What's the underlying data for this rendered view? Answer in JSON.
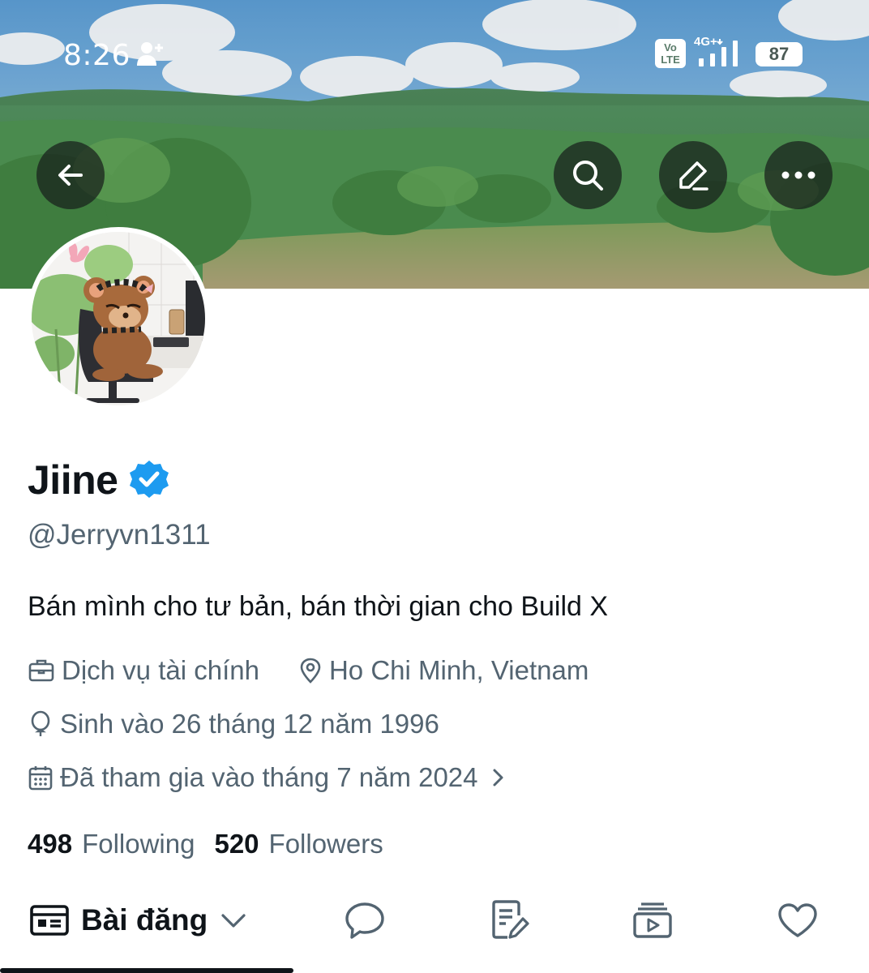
{
  "status_bar": {
    "time": "8:26",
    "volte_top": "Vo",
    "volte_bottom": "LTE",
    "network": "4G+",
    "battery": "87"
  },
  "header_buttons": {
    "back": "back-arrow-icon",
    "search": "search-icon",
    "edit": "edit-pencil-icon",
    "more": "more-dots-icon"
  },
  "profile": {
    "display_name": "Jiine",
    "verified": true,
    "handle": "@Jerryvn1311",
    "bio": "Bán mình cho tư bản, bán thời gian cho Build X",
    "category": "Dịch vụ tài chính",
    "location": "Ho Chi Minh, Vietnam",
    "birthday": "Sinh vào 26 tháng 12 năm 1996",
    "joined": "Đã tham gia vào tháng 7 năm 2024",
    "following_count": "498",
    "following_label": "Following",
    "followers_count": "520",
    "followers_label": "Followers"
  },
  "tabs": {
    "posts_label": "Bài đăng",
    "items": [
      "posts-icon",
      "replies-icon",
      "articles-icon",
      "media-icon",
      "likes-icon"
    ],
    "active": "posts"
  },
  "colors": {
    "text_primary": "#0f1419",
    "text_secondary": "#536471",
    "verified_blue": "#1d9bf0",
    "button_overlay": "#181e1c"
  }
}
